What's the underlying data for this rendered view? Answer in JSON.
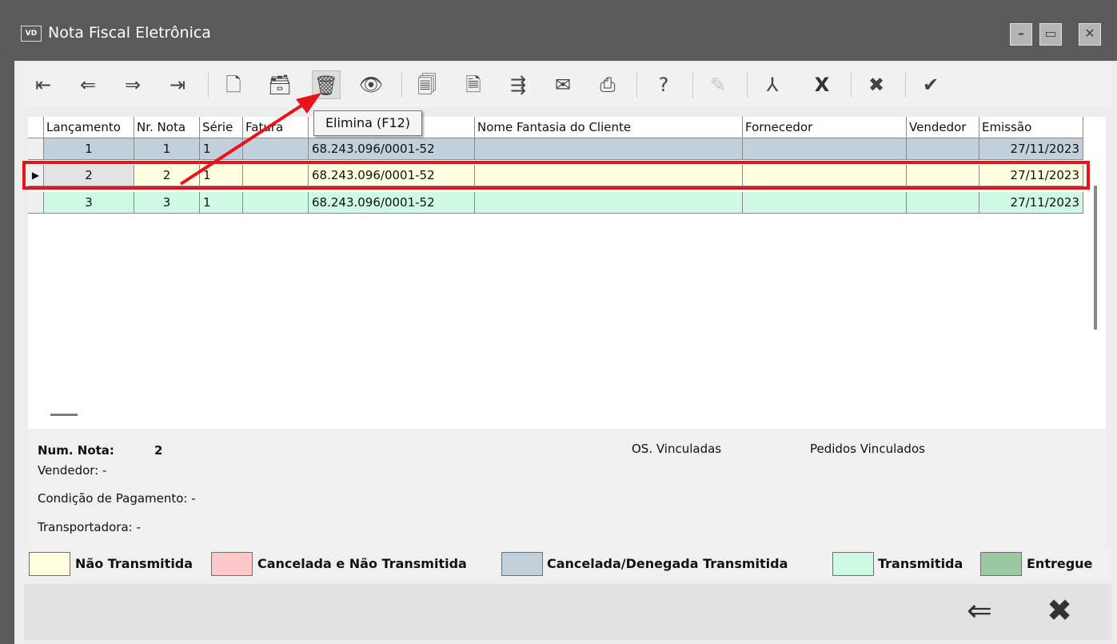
{
  "window": {
    "icon_text": "VD",
    "title": "Nota Fiscal Eletrônica",
    "minimize_glyph": "–",
    "maximize_glyph": "▭",
    "close_glyph": "✕"
  },
  "toolbar": {
    "buttons": [
      {
        "name": "first-record-icon",
        "glyph": "⇤"
      },
      {
        "name": "previous-record-icon",
        "glyph": "⇐"
      },
      {
        "name": "next-record-icon",
        "glyph": "⇒"
      },
      {
        "name": "last-record-icon",
        "glyph": "⇥"
      },
      {
        "name": "new-document-icon",
        "glyph": "🗋"
      },
      {
        "name": "edit-card-icon",
        "glyph": "🗃"
      },
      {
        "name": "trash-icon",
        "glyph": "🗑"
      },
      {
        "name": "view-eye-icon",
        "glyph": "👁"
      },
      {
        "name": "cancel-document-icon",
        "glyph": "🗐"
      },
      {
        "name": "document-arrow-icon",
        "glyph": "🗎"
      },
      {
        "name": "transmit-icon",
        "glyph": "⇶"
      },
      {
        "name": "mail-icon",
        "glyph": "✉"
      },
      {
        "name": "print-icon",
        "glyph": "⎙"
      },
      {
        "name": "help-icon",
        "glyph": "?"
      },
      {
        "name": "edit-disabled-icon",
        "glyph": "✎"
      },
      {
        "name": "pdf-icon",
        "glyph": "⅄"
      },
      {
        "name": "excel-icon",
        "glyph": "X"
      },
      {
        "name": "cancel-circle-icon",
        "glyph": "✖"
      },
      {
        "name": "confirm-circle-icon",
        "glyph": "✔"
      }
    ],
    "tooltip": "Elimina (F12)"
  },
  "table": {
    "columns": [
      "Lançamento",
      "Nr. Nota",
      "Série",
      "Fatura",
      "",
      "Nome Fantasia do Cliente",
      "Fornecedor",
      "Vendedor",
      "Emissão"
    ],
    "rows": [
      {
        "lancamento": "1",
        "nr_nota": "1",
        "serie": "1",
        "fatura": "",
        "cnpj": "68.243.096/0001-52",
        "nome": "",
        "fornecedor": "",
        "vendedor": "",
        "emissao": "27/11/2023",
        "color": "#c2d0dc"
      },
      {
        "lancamento": "2",
        "nr_nota": "2",
        "serie": "1",
        "fatura": "",
        "cnpj": "68.243.096/0001-52",
        "nome": "",
        "fornecedor": "",
        "vendedor": "",
        "emissao": "27/11/2023",
        "color": "#fffee0",
        "selected": true
      },
      {
        "lancamento": "3",
        "nr_nota": "3",
        "serie": "1",
        "fatura": "",
        "cnpj": "68.243.096/0001-52",
        "nome": "",
        "fornecedor": "",
        "vendedor": "",
        "emissao": "27/11/2023",
        "color": "#cff9e5"
      }
    ]
  },
  "info": {
    "num_nota_label": "Num. Nota:",
    "num_nota_value": "2",
    "vendedor": "Vendedor: -",
    "condicao": "Condição de Pagamento: -",
    "transportadora": "Transportadora: -",
    "os_vinculadas": "OS. Vinculadas",
    "pedidos_vinculados": "Pedidos Vinculados"
  },
  "legend": [
    {
      "label": "Não Transmitida",
      "color": "#fffee0"
    },
    {
      "label": "Cancelada e Não Transmitida",
      "color": "#ffc8cc"
    },
    {
      "label": "Cancelada/Denegada Transmitida",
      "color": "#c2d0dc"
    },
    {
      "label": "Transmitida",
      "color": "#cff9e5"
    },
    {
      "label": "Entregue",
      "color": "#9cc9a2"
    }
  ],
  "bottom": {
    "back_glyph": "⇐",
    "close_glyph": "✖"
  },
  "colors": {
    "highlight": "#e8141a",
    "annotation_arrow": "#e8141a"
  }
}
